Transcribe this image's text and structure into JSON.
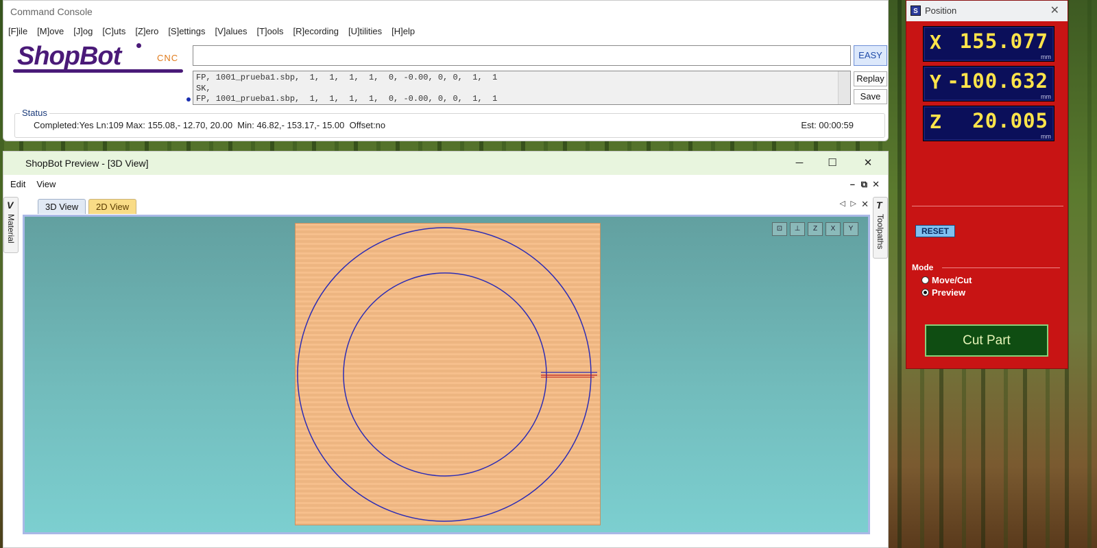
{
  "console": {
    "title": "Command Console",
    "menu": [
      "[F]ile",
      "[M]ove",
      "[J]og",
      "[C]uts",
      "[Z]ero",
      "[S]ettings",
      "[V]alues",
      "[T]ools",
      "[R]ecording",
      "[U]tilities",
      "[H]elp"
    ],
    "logo_text": "ShopBot",
    "logo_suffix": "CNC",
    "input_value": "",
    "easy_label": "EASY",
    "log_lines": [
      "FP, 1001_prueba1.sbp,  1,  1,  1,  1,  0, -0.00, 0, 0,  1,  1",
      "SK,",
      "FP, 1001_prueba1.sbp,  1,  1,  1,  1,  0, -0.00, 0, 0,  1,  1"
    ],
    "replay_label": "Replay",
    "save_label": "Save",
    "status_legend": "Status",
    "status_text": "Completed:Yes Ln:109 Max: 155.08,- 12.70, 20.00  Min: 46.82,- 153.17,- 15.00  Offset:no",
    "est_text": "Est: 00:00:59"
  },
  "preview": {
    "title": "ShopBot Preview - [3D View]",
    "menu": [
      "Edit",
      "View"
    ],
    "left_tab": "Material",
    "right_tab": "Toolpaths",
    "tabs": [
      "3D View",
      "2D View"
    ],
    "active_tab": "3D View",
    "view_icons": [
      "fit-view-icon",
      "iso-view-icon",
      "top-z-view-icon",
      "front-x-view-icon",
      "side-y-view-icon"
    ],
    "colors": {
      "material": "#f5bb85",
      "toolpath": "#2c2cb4",
      "rapid": "#c01818",
      "background": "#6aaeae"
    }
  },
  "position": {
    "title": "Position",
    "axes": [
      {
        "axis": "X",
        "value": "155.077",
        "unit": "mm"
      },
      {
        "axis": "Y",
        "value": "-100.632",
        "unit": "mm"
      },
      {
        "axis": "Z",
        "value": "20.005",
        "unit": "mm"
      }
    ],
    "reset_label": "RESET",
    "mode_label": "Mode",
    "modes": [
      "Move/Cut",
      "Preview"
    ],
    "selected_mode": "Preview",
    "cut_label": "Cut Part",
    "colors": {
      "panel": "#c81414",
      "dro_bg": "#0b0f5a",
      "dro_text": "#ffe44a",
      "cut_button": "#0f4d12"
    }
  }
}
